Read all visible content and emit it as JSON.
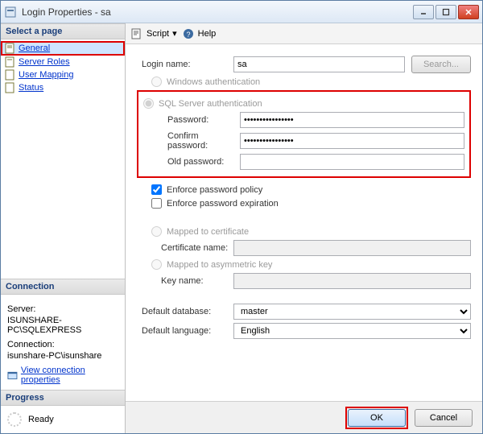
{
  "window": {
    "title": "Login Properties - sa"
  },
  "sidebar": {
    "select_page": "Select a page",
    "items": [
      {
        "label": "General"
      },
      {
        "label": "Server Roles"
      },
      {
        "label": "User Mapping"
      },
      {
        "label": "Status"
      }
    ],
    "connection_head": "Connection",
    "server_label": "Server:",
    "server_value": "ISUNSHARE-PC\\SQLEXPRESS",
    "connection_label": "Connection:",
    "connection_value": "isunshare-PC\\isunshare",
    "view_props": "View connection properties",
    "progress_head": "Progress",
    "progress_status": "Ready"
  },
  "toolbar": {
    "script": "Script",
    "help": "Help"
  },
  "form": {
    "login_name_label": "Login name:",
    "login_name_value": "sa",
    "search_btn": "Search...",
    "win_auth": "Windows authentication",
    "sql_auth": "SQL Server authentication",
    "password_label": "Password:",
    "password_value": "••••••••••••••••",
    "confirm_label": "Confirm password:",
    "confirm_value": "••••••••••••••••",
    "old_label": "Old password:",
    "old_value": "",
    "enforce_policy": "Enforce password policy",
    "enforce_expiration": "Enforce password expiration",
    "mapped_cert": "Mapped to certificate",
    "cert_name_label": "Certificate name:",
    "mapped_key": "Mapped to asymmetric key",
    "key_name_label": "Key name:",
    "default_db_label": "Default database:",
    "default_db_value": "master",
    "default_lang_label": "Default language:",
    "default_lang_value": "English"
  },
  "footer": {
    "ok": "OK",
    "cancel": "Cancel"
  }
}
